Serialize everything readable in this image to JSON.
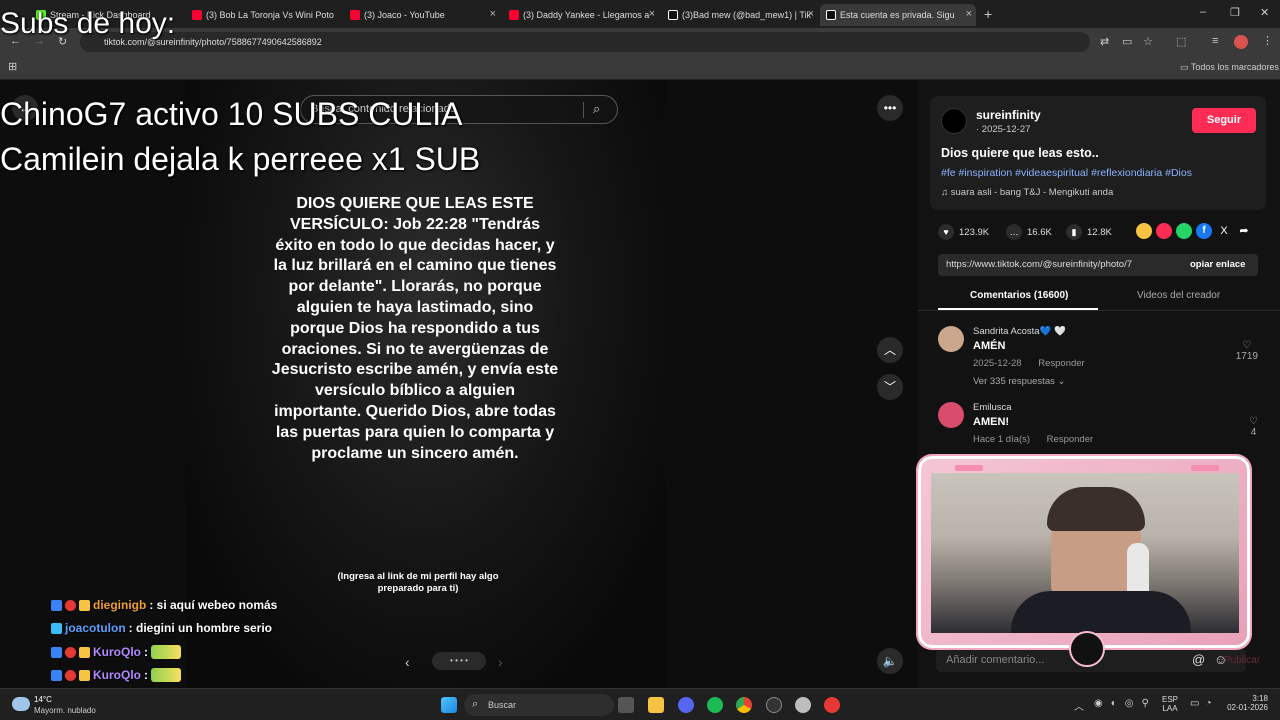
{
  "browser": {
    "tabs": [
      {
        "label": "Stream - Kick Dashboard",
        "color": "#53fc18"
      },
      {
        "label": "(3) Bob La Toronja Vs Wini Poto",
        "color": "#ff0033"
      },
      {
        "label": "(3) Joaco - YouTube",
        "color": "#ff0033"
      },
      {
        "label": "(3) Daddy Yankee - Llegamos a",
        "color": "#ff0033"
      },
      {
        "label": "(3)Bad mew (@bad_mew1) | Tik",
        "color": "#ffffff"
      },
      {
        "label": "Esta cuenta es privada. Sigu",
        "color": "#ffffff"
      }
    ],
    "new_tab": "+",
    "url": "tiktok.com/@sureinfinity/photo/7588677490642586892",
    "bookmarks_label": "Todos los marcadores"
  },
  "overlay": {
    "subs_title": "Subs de hoy:",
    "subs_line1": "ChinoG7 activo 10 SUBS CULIA",
    "subs_line2": "Camilein dejala k perreee x1 SUB"
  },
  "chat": [
    {
      "user": "dieginigb",
      "message": ": si aquí webeo nomás",
      "color": "#f0a030"
    },
    {
      "user": "joacotulon",
      "message": ": diegini un hombre serio",
      "color": "#5aa0ff"
    },
    {
      "user": "KuroQlo",
      "message": " :",
      "color": "#b388ff"
    },
    {
      "user": "KuroQlo",
      "message": " :",
      "color": "#b388ff"
    }
  ],
  "viewer": {
    "search_placeholder": "Buscar contenido relacionado",
    "verse": "DIOS QUIERE QUE LEAS ESTE VERSÍCULO: Job 22:28 \"Tendrás éxito en todo lo que decidas hacer, y la luz brillará en el camino que tienes por delante\". Llorarás, no porque alguien te haya lastimado, sino porque Dios ha respondido a tus oraciones. Si no te avergüenzas de Jesucristo escribe amén, y envía este versículo bíblico a alguien importante. Querido Dios, abre todas las puertas para quien lo comparta y proclame un sincero amén.",
    "footer": "(Ingresa al link de mi perfil hay algo preparado para ti)"
  },
  "post": {
    "author": "sureinfinity",
    "date": "· 2025-12-27",
    "follow_label": "Seguir",
    "title": "Dios quiere que leas esto..",
    "hashtags": "#fe #inspiration #videaespiritual #reflexiondiaria #Dios",
    "sound": "suara asli - bang T&J - Mengikuti anda",
    "likes": "123.9K",
    "comments": "16.6K",
    "saves": "12.8K",
    "link": "https://www.tiktok.com/@sureinfinity/photo/7",
    "copy_label": "opiar enlace",
    "tab_comments": "Comentarios (16600)",
    "tab_creator": "Videos del creador"
  },
  "comments": [
    {
      "name": "Sandrita Acosta💙 🤍",
      "text": "AMÉN",
      "date": "2025-12-28",
      "reply": "Responder",
      "likes": "1719",
      "more": "Ver 335 respuestas"
    },
    {
      "name": "Emilusca",
      "text": "AMEN!",
      "date": "Hace 1 día(s)",
      "reply": "Responder",
      "likes": "4"
    }
  ],
  "composer": {
    "placeholder": "Añadir comentario...",
    "post_label": "Publicar"
  },
  "taskbar": {
    "temp": "14°C",
    "weather": "Mayorm. nublado",
    "search": "Buscar",
    "lang": "ESP",
    "lang2": "LAA",
    "time": "3:18",
    "date": "02-01-2026"
  }
}
